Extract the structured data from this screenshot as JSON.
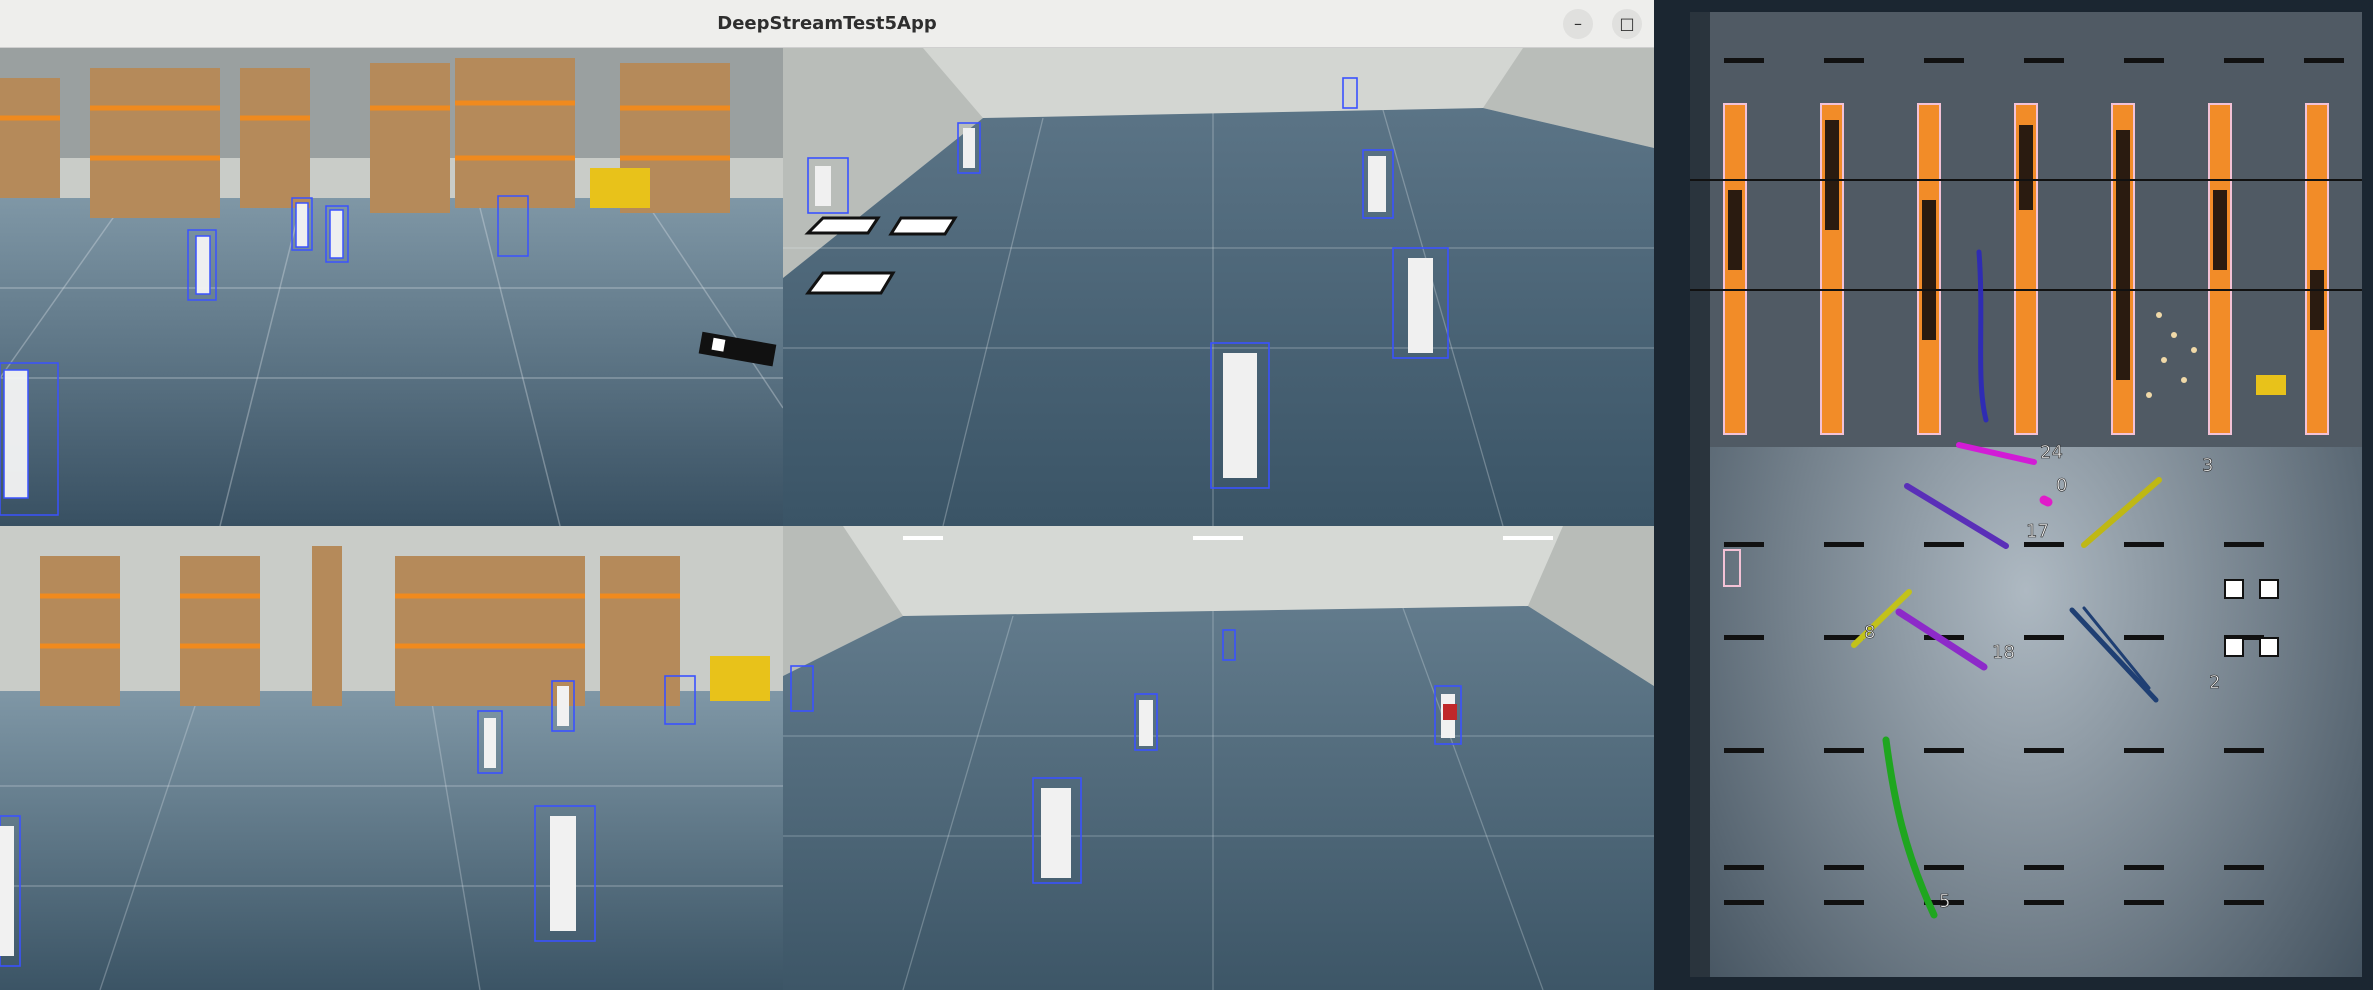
{
  "window": {
    "title": "DeepStreamTest5App",
    "minimize_glyph": "–",
    "maximize_glyph": "□",
    "close_glyph": "✕"
  },
  "icons": {
    "minimize": "minimize-icon",
    "maximize": "maximize-icon",
    "close": "close-icon"
  },
  "colors": {
    "titlebar": "#eeeeec",
    "rack_orange": "#f28c28",
    "bbox_blue": "#3a52ff",
    "floor": "#3d5566"
  },
  "tracks": [
    {
      "id": "24",
      "color": "#d21cd6"
    },
    {
      "id": "0",
      "color": "#e01cc9"
    },
    {
      "id": "3",
      "color": "#bfb814"
    },
    {
      "id": "17",
      "color": "#5a2fb8"
    },
    {
      "id": "8",
      "color": "#c2c21a"
    },
    {
      "id": "18",
      "color": "#8d2ac9"
    },
    {
      "id": "2",
      "color": "#1f3f73"
    },
    {
      "id": "5",
      "color": "#1fa61f"
    }
  ]
}
